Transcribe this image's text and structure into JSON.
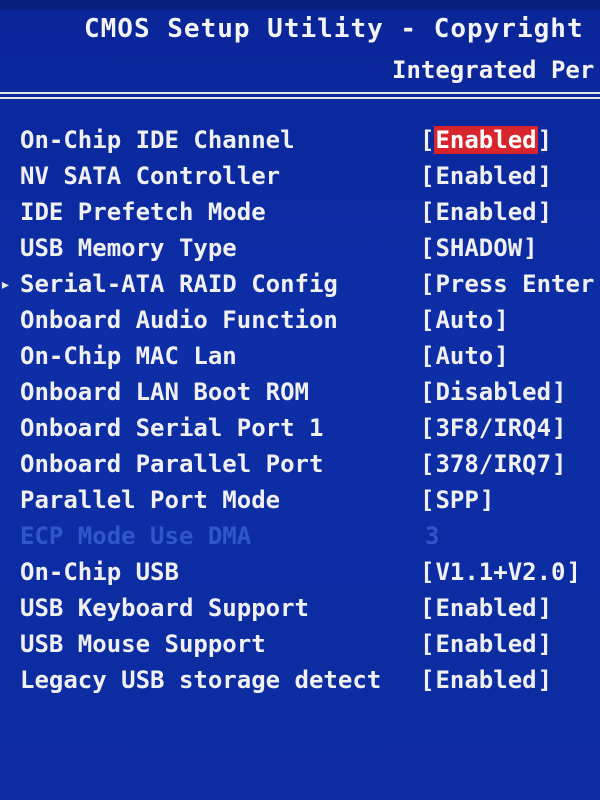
{
  "header": {
    "title": "CMOS Setup Utility - Copyright (C)",
    "subtitle": "Integrated Per"
  },
  "colors": {
    "background": "#0c2ba0",
    "text": "#f0f0f0",
    "highlight": "#d8242c",
    "disabled_text": "#2f58c6"
  },
  "settings": [
    {
      "label": "On-Chip IDE Channel",
      "value": "Enabled",
      "selected": true
    },
    {
      "label": "NV SATA Controller",
      "value": "Enabled"
    },
    {
      "label": "IDE Prefetch Mode",
      "value": "Enabled"
    },
    {
      "label": "USB Memory Type",
      "value": "SHADOW"
    },
    {
      "label": "Serial-ATA RAID Config",
      "value": "Press Enter",
      "submenu": true
    },
    {
      "label": "Onboard Audio Function",
      "value": "Auto"
    },
    {
      "label": "On-Chip MAC Lan",
      "value": "Auto"
    },
    {
      "label": "Onboard LAN Boot ROM",
      "value": "Disabled"
    },
    {
      "label": "Onboard Serial Port 1",
      "value": "3F8/IRQ4"
    },
    {
      "label": "Onboard Parallel Port",
      "value": "378/IRQ7"
    },
    {
      "label": "Parallel Port Mode",
      "value": "SPP"
    },
    {
      "label": "ECP Mode Use DMA",
      "value": "3",
      "disabled": true
    },
    {
      "label": "On-Chip USB",
      "value": "V1.1+V2.0"
    },
    {
      "label": "USB Keyboard Support",
      "value": "Enabled"
    },
    {
      "label": "USB Mouse Support",
      "value": "Enabled"
    },
    {
      "label": "Legacy USB storage detect",
      "value": "Enabled"
    }
  ]
}
